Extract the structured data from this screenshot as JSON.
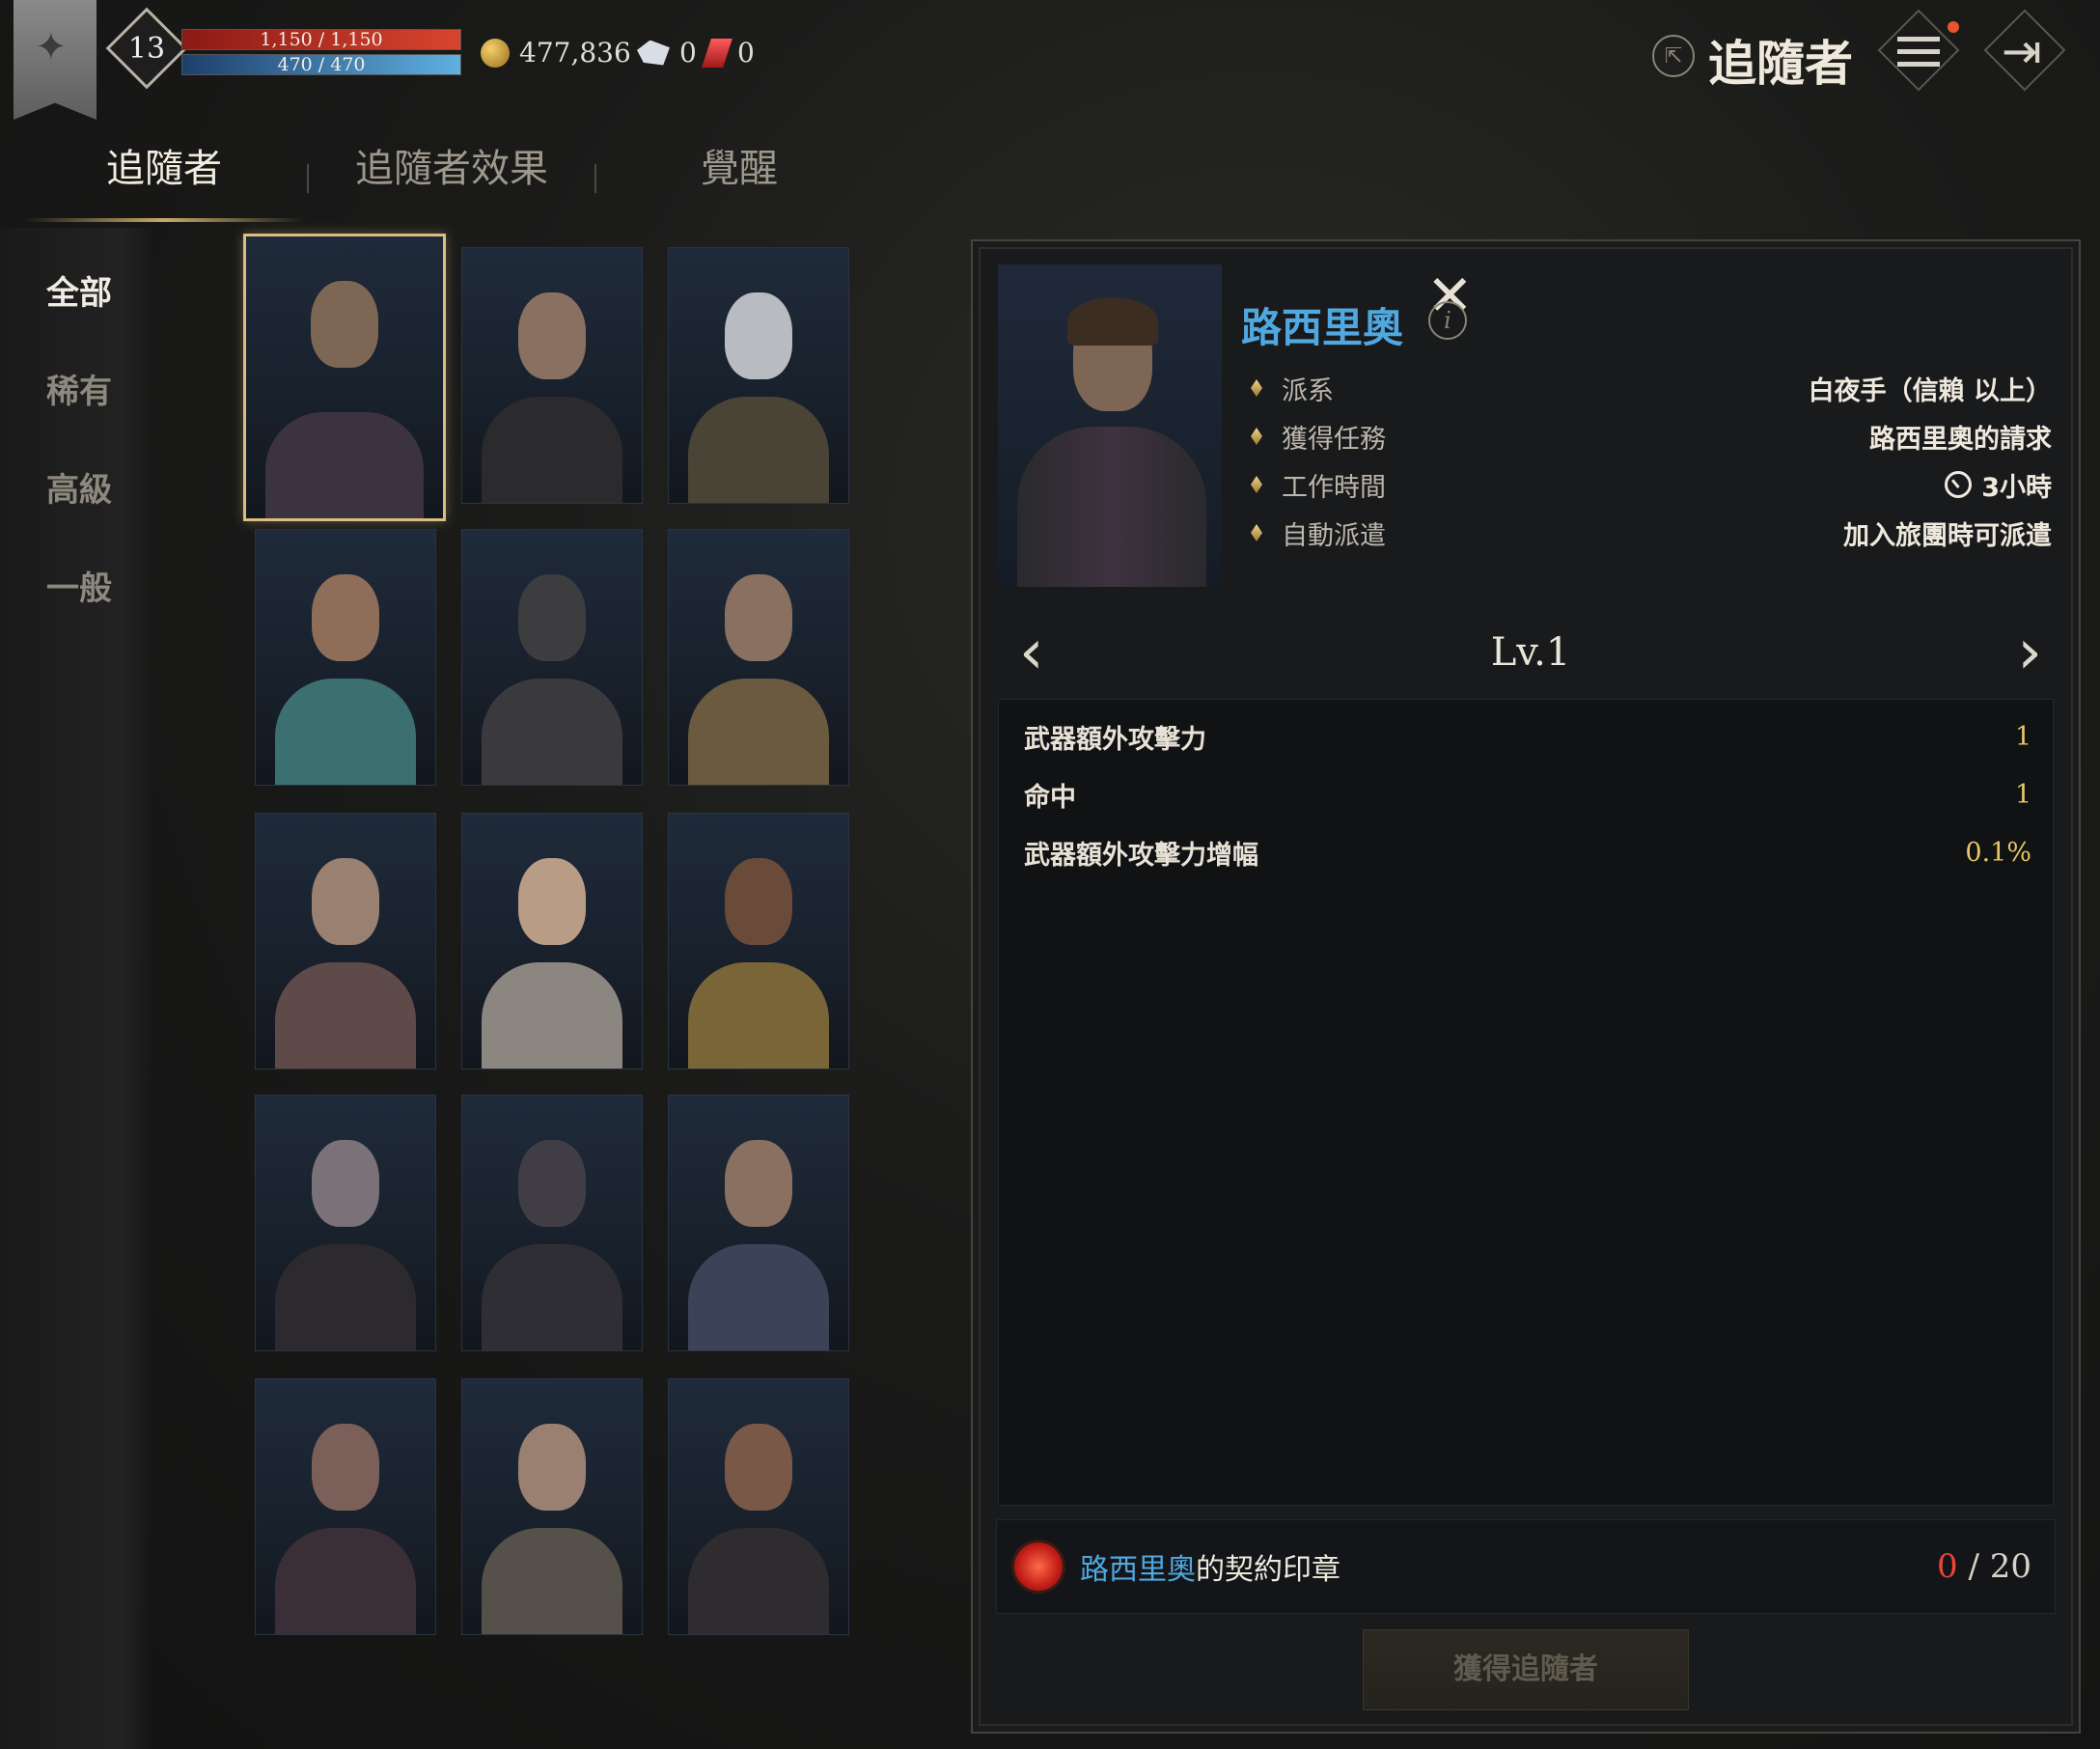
{
  "header": {
    "level": "13",
    "hp": "1,150 / 1,150",
    "mp": "470 / 470",
    "gold": "477,836",
    "crystal": "0",
    "ruby": "0",
    "title": "追隨者"
  },
  "tabs": [
    {
      "label": "追隨者",
      "active": true
    },
    {
      "label": "追隨者效果",
      "active": false
    },
    {
      "label": "覺醒",
      "active": false
    }
  ],
  "categories": [
    {
      "label": "全部",
      "active": true
    },
    {
      "label": "稀有",
      "active": false
    },
    {
      "label": "高級",
      "active": false
    },
    {
      "label": "一般",
      "active": false
    }
  ],
  "follower_cards": [
    {
      "selected": true,
      "skin": "#7d6654",
      "outfit": "#3c3340"
    },
    {
      "selected": false,
      "skin": "#8a7060",
      "outfit": "#2b2b2d"
    },
    {
      "selected": false,
      "skin": "#b8bcc0",
      "outfit": "#4a4436"
    },
    {
      "selected": false,
      "skin": "#8e6e58",
      "outfit": "#3b6f70"
    },
    {
      "selected": false,
      "skin": "#3d3d40",
      "outfit": "#3a3a3e"
    },
    {
      "selected": false,
      "skin": "#8a7060",
      "outfit": "#6b5a40"
    },
    {
      "selected": false,
      "skin": "#9a8070",
      "outfit": "#5e4a48"
    },
    {
      "selected": false,
      "skin": "#b89c86",
      "outfit": "#8c8680"
    },
    {
      "selected": false,
      "skin": "#6a4a38",
      "outfit": "#7a6538"
    },
    {
      "selected": false,
      "skin": "#7a7278",
      "outfit": "#2c2a2e"
    },
    {
      "selected": false,
      "skin": "#403e44",
      "outfit": "#2e2e34"
    },
    {
      "selected": false,
      "skin": "#8a7060",
      "outfit": "#3c4258"
    },
    {
      "selected": false,
      "skin": "#7a6058",
      "outfit": "#3a2f36"
    },
    {
      "selected": false,
      "skin": "#9a8070",
      "outfit": "#56504a"
    },
    {
      "selected": false,
      "skin": "#7a5848",
      "outfit": "#2e2c2e"
    }
  ],
  "detail": {
    "name": "路西里奧",
    "attributes": [
      {
        "key": "派系",
        "value": "白夜手（信賴 以上）"
      },
      {
        "key": "獲得任務",
        "value": "路西里奧的請求"
      },
      {
        "key": "工作時間",
        "value": "3小時",
        "icon": "clock-icon"
      },
      {
        "key": "自動派遣",
        "value": "加入旅團時可派遣"
      }
    ],
    "level": "Lv.1",
    "stats": [
      {
        "key": "武器額外攻擊力",
        "value": "1"
      },
      {
        "key": "命中",
        "value": "1"
      },
      {
        "key": "武器額外攻擊力增幅",
        "value": "0.1%"
      }
    ],
    "seal": {
      "name": "路西里奧",
      "suffix": "的契約印章",
      "owned": "0",
      "separator": "/",
      "required": "20"
    },
    "acquire_label": "獲得追隨者"
  },
  "colors": {
    "accent_gold": "#d9bd82",
    "name_blue": "#4fa8e0",
    "stat_value": "#e7c766",
    "seal_owned_red": "#e8463a"
  }
}
